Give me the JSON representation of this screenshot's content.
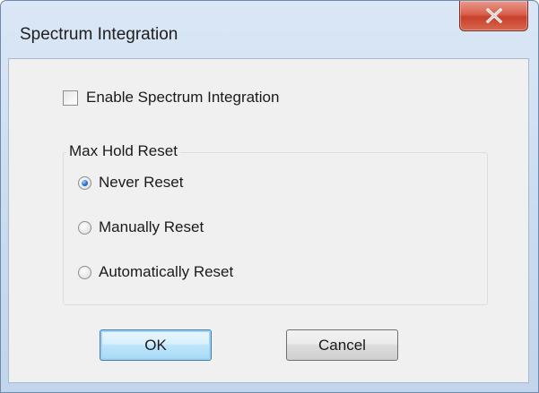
{
  "window": {
    "title": "Spectrum Integration",
    "close_glyph": "X"
  },
  "integration": {
    "checkbox_label": "Enable Spectrum Integration",
    "checked": false
  },
  "max_hold_reset": {
    "group_label": "Max Hold Reset",
    "options": [
      {
        "label": "Never Reset",
        "selected": true
      },
      {
        "label": "Manually Reset",
        "selected": false
      },
      {
        "label": "Automatically Reset",
        "selected": false
      }
    ]
  },
  "buttons": {
    "ok_label": "OK",
    "cancel_label": "Cancel"
  },
  "colors": {
    "frame": "#c9dbf0",
    "close_button": "#c8402c",
    "client": "#f0f0f0",
    "radio_selected": "#2a6fc9"
  },
  "icons": {
    "close": "close-icon",
    "checkbox": "checkbox-icon",
    "radio": "radio-icon"
  }
}
